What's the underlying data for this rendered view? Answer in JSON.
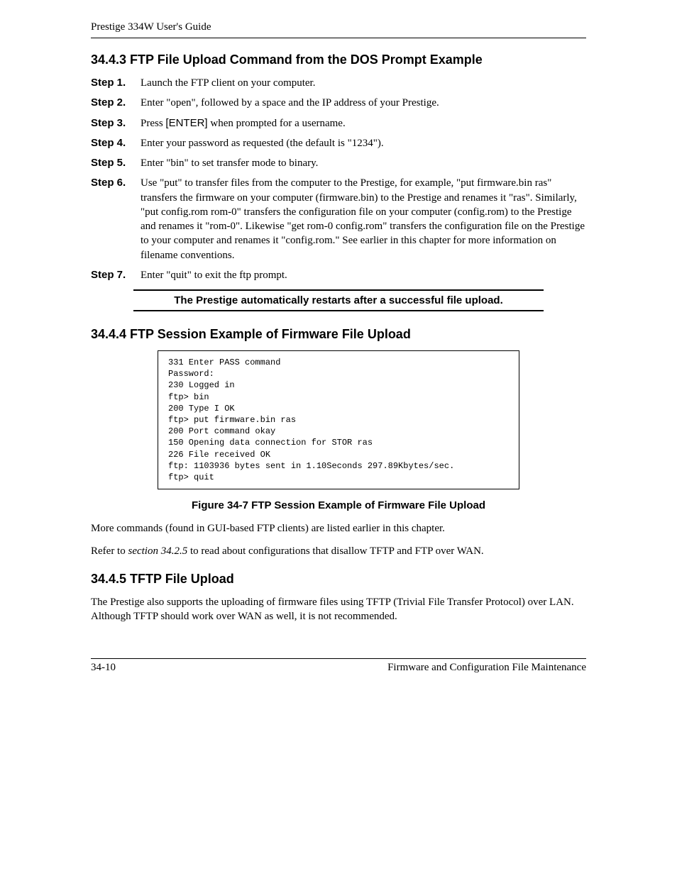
{
  "header": {
    "title": "Prestige 334W User's Guide"
  },
  "section_3443": {
    "heading": "34.4.3 FTP File Upload Command from the DOS Prompt Example",
    "steps": [
      {
        "label": "Step 1.",
        "text": "Launch the FTP client on your computer."
      },
      {
        "label": "Step 2.",
        "text": "Enter \"open\", followed by a space and the IP address of your Prestige."
      },
      {
        "label": "Step 3.",
        "text_before": "Press ",
        "key": "[ENTER]",
        "text_after": " when prompted for a username."
      },
      {
        "label": "Step 4.",
        "text": "Enter your password as requested (the default is \"1234\")."
      },
      {
        "label": "Step 5.",
        "text": "Enter \"bin\" to set transfer mode to binary."
      },
      {
        "label": "Step 6.",
        "text": "Use \"put\" to transfer files from the computer to the Prestige, for example, \"put firmware.bin ras\" transfers the firmware on your computer (firmware.bin) to the Prestige and renames it \"ras\". Similarly, \"put config.rom rom-0\" transfers the configuration file on your computer (config.rom) to the Prestige and renames it \"rom-0\". Likewise \"get rom-0 config.rom\" transfers the configuration file on the Prestige to your computer and renames it \"config.rom.\" See earlier in this chapter for more information on filename conventions."
      },
      {
        "label": "Step 7.",
        "text": "Enter \"quit\" to exit the ftp prompt."
      }
    ],
    "note": "The Prestige automatically restarts after a successful file upload."
  },
  "section_3444": {
    "heading": "34.4.4 FTP Session Example of Firmware File Upload",
    "code": "331 Enter PASS command\nPassword:\n230 Logged in\nftp> bin\n200 Type I OK\nftp> put firmware.bin ras\n200 Port command okay\n150 Opening data connection for STOR ras\n226 File received OK\nftp: 1103936 bytes sent in 1.10Seconds 297.89Kbytes/sec.\nftp> quit",
    "fig_caption": "Figure 34-7 FTP Session Example of Firmware File Upload",
    "para1": "More commands (found in GUI-based FTP clients) are listed earlier in this chapter.",
    "para2_before": "Refer to ",
    "para2_ref": "section 34.2.5",
    "para2_after": " to read about configurations that disallow TFTP and FTP over WAN."
  },
  "section_3445": {
    "heading": "34.4.5 TFTP File Upload",
    "para": "The Prestige also supports the uploading of firmware files using TFTP (Trivial File Transfer Protocol) over LAN. Although TFTP should work over WAN as well, it is not recommended."
  },
  "footer": {
    "page_number": "34-10",
    "chapter": "Firmware and Configuration File Maintenance"
  }
}
